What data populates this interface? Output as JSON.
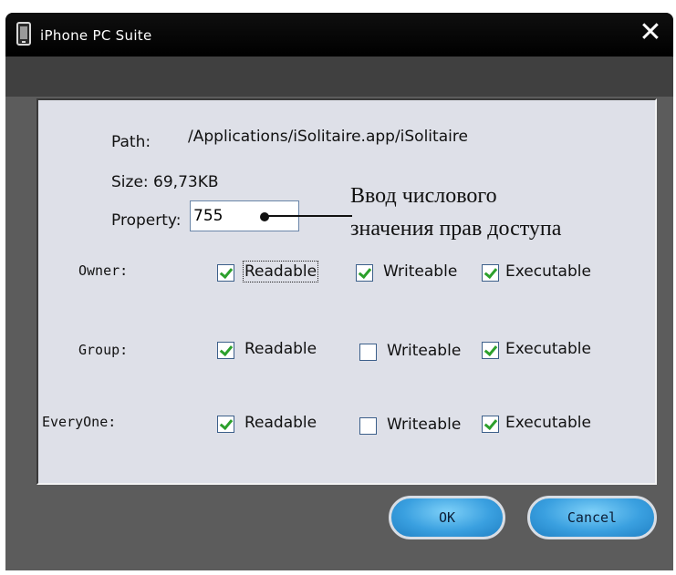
{
  "window": {
    "title": "iPhone PC Suite",
    "close_symbol": "✕"
  },
  "info": {
    "path_label": "Path:",
    "path_value": "/Applications/iSolitaire.app/iSolitaire",
    "size_text": "Size: 69,73KB",
    "property_label": "Property:",
    "property_value": "755"
  },
  "annotation": {
    "line1": "Ввод числового",
    "line2": "значения прав доступа"
  },
  "permissions": {
    "owner": {
      "label": "Owner:",
      "readable": {
        "label": "Readable",
        "checked": true
      },
      "writeable": {
        "label": "Writeable",
        "checked": true
      },
      "executable": {
        "label": "Executable",
        "checked": true
      }
    },
    "group": {
      "label": "Group:",
      "readable": {
        "label": "Readable",
        "checked": true
      },
      "writeable": {
        "label": "Writeable",
        "checked": false
      },
      "executable": {
        "label": "Executable",
        "checked": true
      }
    },
    "everyone": {
      "label": "EveryOne:",
      "readable": {
        "label": "Readable",
        "checked": true
      },
      "writeable": {
        "label": "Writeable",
        "checked": false
      },
      "executable": {
        "label": "Executable",
        "checked": true
      }
    }
  },
  "buttons": {
    "ok": "OK",
    "cancel": "Cancel"
  },
  "colors": {
    "panel": "#dee0e8",
    "frame": "#5c5c5c",
    "titlebar": "#000000",
    "check": "#2ca02c",
    "button": "#3aa0e0"
  }
}
